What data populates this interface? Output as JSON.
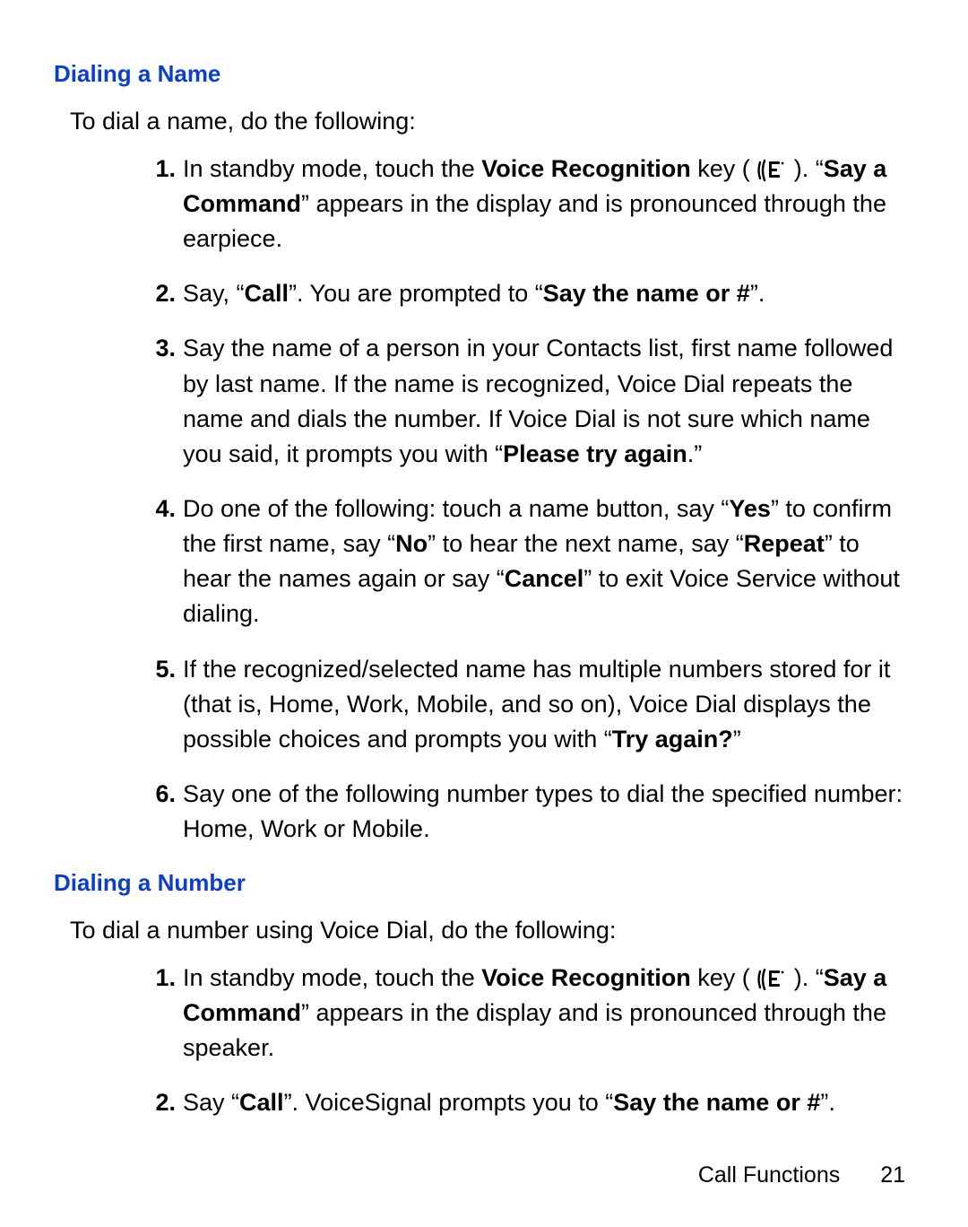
{
  "sections": [
    {
      "heading": "Dialing a Name",
      "intro": "To dial a name, do the following:",
      "steps": [
        {
          "html": "In standby mode, touch the <span class='cond'>Voice Recognition</span> key ( {ICON_VOICE} ). “<span class='bold'>Say a Command</span>” appears in the display and is pronounced through the earpiece."
        },
        {
          "html": "Say, “<span class='bold'>Call</span>”. You are prompted to “<span class='bold'>Say the name or #</span>”."
        },
        {
          "html": "Say the name of a person in your Contacts list, first name followed by last name. If the name is recognized, Voice Dial repeats the name and dials the number. If Voice Dial is not sure which name you said, it prompts you with “<span class='bold'>Please try again</span>.”"
        },
        {
          "html": "Do one of the following: touch a name button, say “<span class='cond'>Yes</span>” to confirm the first name, say “<span class='cond'>No</span>” to hear the next name, say “<span class='cond'>Repeat</span>” to hear the names again or say “<span class='cond'>Cancel</span>” to exit Voice Service without dialing."
        },
        {
          "html": "If the recognized/selected name has multiple numbers stored for it (that is, Home, Work, Mobile, and so on), Voice Dial displays the possible choices and prompts you with “<span class='bold'>Try again?</span>”"
        },
        {
          "html": "Say one of the following number types to dial the specified number: Home, Work or Mobile."
        }
      ]
    },
    {
      "heading": "Dialing a Number",
      "intro": "To dial a number using Voice Dial, do the following:",
      "steps": [
        {
          "html": "In standby mode, touch the <span class='cond'>Voice Recognition</span> key ( {ICON_VOICE} ). “<span class='bold'>Say a Command</span>” appears in the display and is pronounced through the speaker."
        },
        {
          "html": "Say “<span class='bold'>Call</span>”. VoiceSignal prompts you to “<span class='bold'>Say the name or #</span>”."
        }
      ]
    }
  ],
  "footer": {
    "section": "Call Functions",
    "page": "21"
  },
  "icons": {
    "voice_name": "voice-recognition-icon"
  }
}
